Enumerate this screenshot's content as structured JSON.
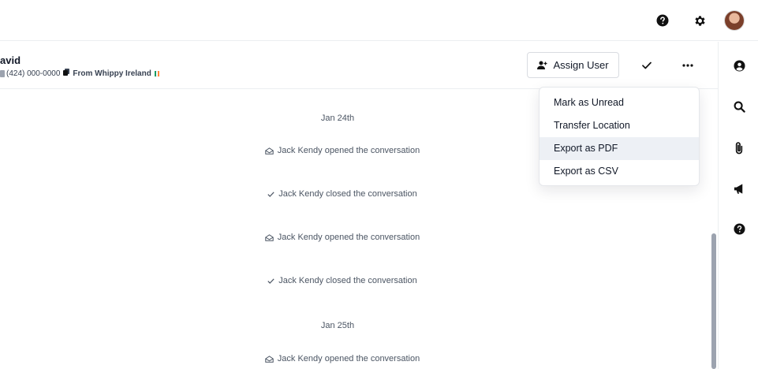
{
  "contact": {
    "name": "avid",
    "phone": "(424) 000-0000",
    "location": "From Whippy Ireland"
  },
  "toolbar": {
    "assign_label": "Assign User"
  },
  "menu": {
    "items": [
      {
        "label": "Mark as Unread"
      },
      {
        "label": "Transfer Location"
      },
      {
        "label": "Export as PDF"
      },
      {
        "label": "Export as CSV"
      }
    ],
    "highlighted_index": 2
  },
  "timeline": {
    "dates": [
      "Jan 24th",
      "Jan 25th"
    ],
    "events": [
      {
        "text": "Jack Kendy opened the conversation",
        "icon": "envelope-open-icon"
      },
      {
        "text": "Jack Kendy closed the conversation",
        "icon": "check-icon"
      },
      {
        "text": "Jack Kendy opened the conversation",
        "icon": "envelope-open-icon"
      },
      {
        "text": "Jack Kendy closed the conversation",
        "icon": "check-icon"
      },
      {
        "text": "Jack Kendy opened the conversation",
        "icon": "envelope-open-icon"
      }
    ]
  },
  "icons": {
    "header": [
      "help-icon",
      "gear-icon",
      "avatar"
    ],
    "sidebar": [
      "user-circle-icon",
      "search-icon",
      "paperclip-icon",
      "megaphone-icon",
      "help-icon"
    ]
  },
  "colors": {
    "menu_highlight": "#edf0f5",
    "text_primary": "#111827",
    "text_muted": "#4b5563",
    "divider": "#eceef1"
  }
}
